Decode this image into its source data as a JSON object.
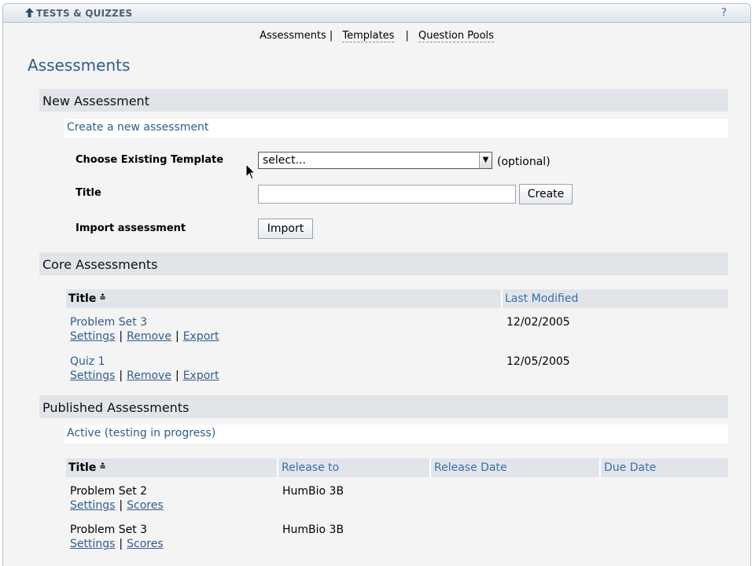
{
  "tool": {
    "title": "TESTS & QUIZZES",
    "help": "?"
  },
  "nav": {
    "items": [
      {
        "label": "Assessments"
      },
      {
        "label": "Templates"
      },
      {
        "label": "Question Pools"
      }
    ],
    "separator": "|"
  },
  "page_title": "Assessments",
  "new_assessment": {
    "header": "New Assessment",
    "subheader": "Create a new assessment",
    "template_label": "Choose Existing Template",
    "template_select_value": "select...",
    "optional": "(optional)",
    "title_label": "Title",
    "title_value": "",
    "create_button": "Create",
    "import_label": "Import assessment",
    "import_button": "Import"
  },
  "core": {
    "header": "Core Assessments",
    "columns": {
      "title": "Title",
      "last_modified": "Last Modified"
    },
    "sort_icon": "≛",
    "rows": [
      {
        "title": "Problem Set 3",
        "last_modified": "12/02/2005",
        "actions": [
          "Settings",
          "Remove",
          "Export"
        ]
      },
      {
        "title": "Quiz 1",
        "last_modified": "12/05/2005",
        "actions": [
          "Settings",
          "Remove",
          "Export"
        ]
      }
    ]
  },
  "published": {
    "header": "Published Assessments",
    "subheader": "Active (testing in progress)",
    "columns": {
      "title": "Title",
      "release_to": "Release to",
      "release_date": "Release Date",
      "due_date": "Due Date"
    },
    "sort_icon": "≛",
    "rows": [
      {
        "title": "Problem Set 2",
        "release_to": "HumBio 3B",
        "actions": [
          "Settings",
          "Scores"
        ]
      },
      {
        "title": "Problem Set 3",
        "release_to": "HumBio 3B",
        "actions": [
          "Settings",
          "Scores"
        ]
      }
    ]
  },
  "colors": {
    "accent": "#2f5d8c",
    "header_bg": "#e1e5ea",
    "page_bg": "#f4f4f4"
  }
}
